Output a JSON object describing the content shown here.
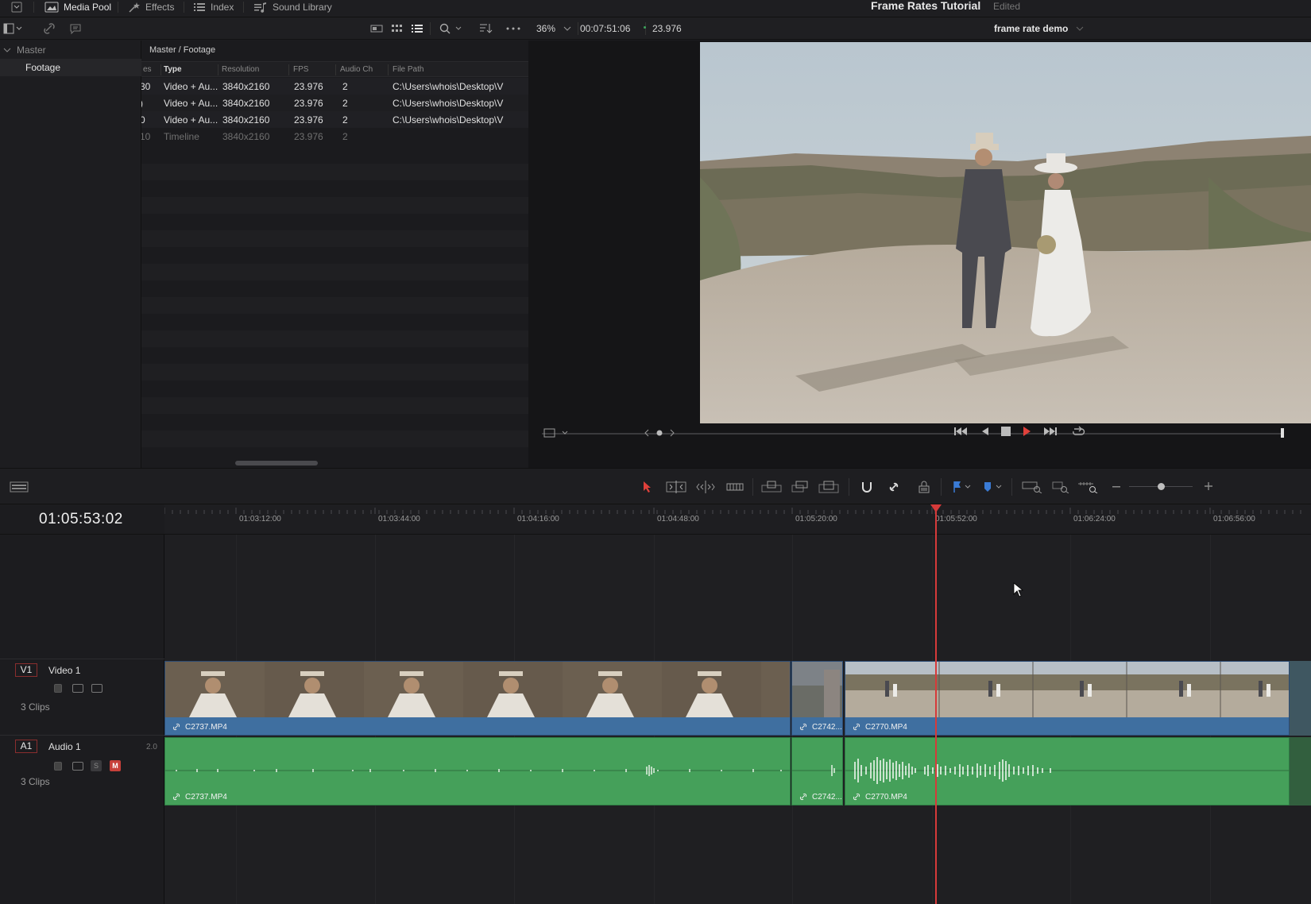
{
  "topbar": {
    "items": [
      {
        "label": "Media Pool",
        "icon": "media-pool-icon",
        "active": true
      },
      {
        "label": "Effects",
        "icon": "effects-icon",
        "active": false
      },
      {
        "label": "Index",
        "icon": "index-icon",
        "active": false
      },
      {
        "label": "Sound Library",
        "icon": "sound-library-icon",
        "active": false
      }
    ],
    "project_title": "Frame Rates Tutorial",
    "project_status": "Edited"
  },
  "viewer_bar": {
    "zoom": "36%",
    "timecode": "00:07:51:06",
    "fps": "23.976",
    "timeline_name": "frame rate demo"
  },
  "bins": {
    "master": "Master",
    "footage": "Footage"
  },
  "media_pool": {
    "path": "Master / Footage",
    "columns": [
      "es",
      "Type",
      "Resolution",
      "FPS",
      "Audio Ch",
      "File Path"
    ],
    "rows": [
      {
        "frames": "30",
        "type": "Video + Au...",
        "resolution": "3840x2160",
        "fps": "23.976",
        "audio_ch": "2",
        "path": "C:\\Users\\whois\\Desktop\\V"
      },
      {
        "frames": ")",
        "type": "Video + Au...",
        "resolution": "3840x2160",
        "fps": "23.976",
        "audio_ch": "2",
        "path": "C:\\Users\\whois\\Desktop\\V"
      },
      {
        "frames": "0",
        "type": "Video + Au...",
        "resolution": "3840x2160",
        "fps": "23.976",
        "audio_ch": "2",
        "path": "C:\\Users\\whois\\Desktop\\V"
      },
      {
        "frames": "10",
        "type": "Timeline",
        "resolution": "3840x2160",
        "fps": "23.976",
        "audio_ch": "2",
        "path": ""
      }
    ]
  },
  "timeline": {
    "timecode": "01:05:53:02",
    "ruler": [
      "01:03:12:00",
      "01:03:44:00",
      "01:04:16:00",
      "01:04:48:00",
      "01:05:20:00",
      "01:05:52:00",
      "01:06:24:00",
      "01:06:56:00"
    ],
    "video_track": {
      "badge": "V1",
      "name": "Video 1",
      "clips_count": "3 Clips"
    },
    "audio_track": {
      "badge": "A1",
      "name": "Audio 1",
      "channels": "2.0",
      "clips_count": "3 Clips",
      "solo": "S",
      "mute": "M"
    },
    "video_clips": [
      "C2737.MP4",
      "C2742...",
      "C2770.MP4"
    ],
    "audio_clips": [
      "C2737.MP4",
      "C2742...",
      "C2770.MP4"
    ]
  },
  "colors": {
    "playhead": "#d63a3a",
    "video_clip": "#37679a",
    "audio_clip": "#45a05a",
    "track_badge_border": "#8a2e2e"
  }
}
